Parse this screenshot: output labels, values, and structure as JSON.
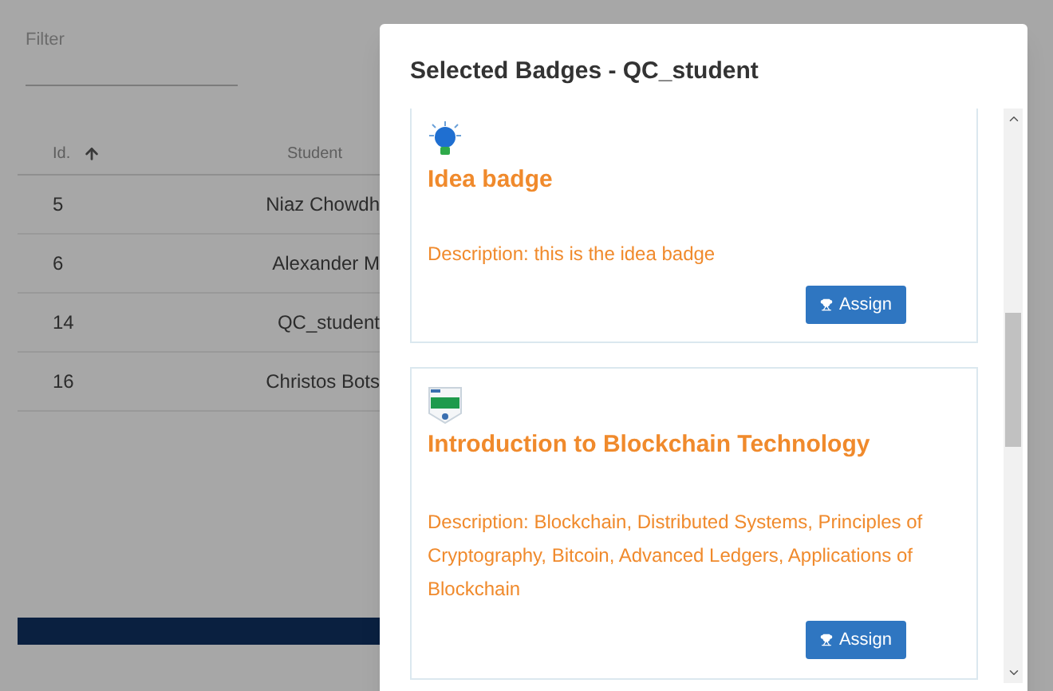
{
  "filter": {
    "label": "Filter"
  },
  "table": {
    "columns": [
      {
        "label": "Id.",
        "sorted": true
      },
      {
        "label": "Student",
        "sorted": false
      }
    ],
    "rows": [
      {
        "id": "5",
        "student": "Niaz Chowdh"
      },
      {
        "id": "6",
        "student": "Alexander M"
      },
      {
        "id": "14",
        "student": "QC_student"
      },
      {
        "id": "16",
        "student": "Christos Bots"
      }
    ]
  },
  "dialog": {
    "title": "Selected Badges - QC_student",
    "badges": [
      {
        "kind": "bulb",
        "title": "Idea badge",
        "description": "Description: this is the idea badge",
        "button": "Assign"
      },
      {
        "kind": "certificate",
        "title": "Introduction to Blockchain Technology",
        "description": "Description: Blockchain, Distributed Systems, Principles of Cryptography, Bitcoin, Advanced Ledgers, Applications of Blockchain",
        "button": "Assign"
      }
    ]
  }
}
